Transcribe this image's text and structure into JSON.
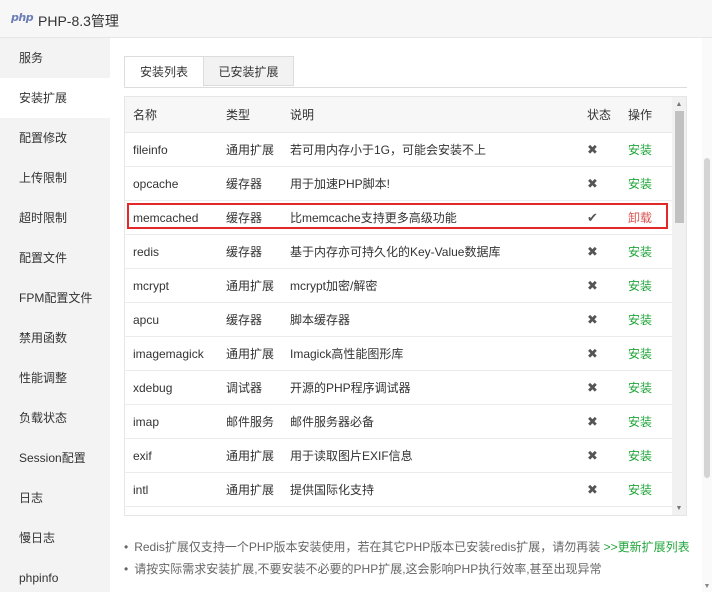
{
  "window": {
    "logo": "php",
    "title": "PHP-8.3管理"
  },
  "sidebar": {
    "items": [
      {
        "label": "服务",
        "active": false
      },
      {
        "label": "安装扩展",
        "active": true
      },
      {
        "label": "配置修改",
        "active": false
      },
      {
        "label": "上传限制",
        "active": false
      },
      {
        "label": "超时限制",
        "active": false
      },
      {
        "label": "配置文件",
        "active": false
      },
      {
        "label": "FPM配置文件",
        "active": false
      },
      {
        "label": "禁用函数",
        "active": false
      },
      {
        "label": "性能调整",
        "active": false
      },
      {
        "label": "负载状态",
        "active": false
      },
      {
        "label": "Session配置",
        "active": false
      },
      {
        "label": "日志",
        "active": false
      },
      {
        "label": "慢日志",
        "active": false
      },
      {
        "label": "phpinfo",
        "active": false
      }
    ]
  },
  "tabs": [
    {
      "label": "安装列表",
      "active": true
    },
    {
      "label": "已安装扩展",
      "active": false
    }
  ],
  "table": {
    "headers": {
      "name": "名称",
      "type": "类型",
      "desc": "说明",
      "status": "状态",
      "action": "操作"
    },
    "rows": [
      {
        "name": "fileinfo",
        "type": "通用扩展",
        "desc": "若可用内存小于1G，可能会安装不上",
        "installed": false,
        "action": "安装"
      },
      {
        "name": "opcache",
        "type": "缓存器",
        "desc": "用于加速PHP脚本!",
        "installed": false,
        "action": "安装"
      },
      {
        "name": "memcached",
        "type": "缓存器",
        "desc": "比memcache支持更多高级功能",
        "installed": true,
        "action": "卸载"
      },
      {
        "name": "redis",
        "type": "缓存器",
        "desc": "基于内存亦可持久化的Key-Value数据库",
        "installed": false,
        "action": "安装"
      },
      {
        "name": "mcrypt",
        "type": "通用扩展",
        "desc": "mcrypt加密/解密",
        "installed": false,
        "action": "安装"
      },
      {
        "name": "apcu",
        "type": "缓存器",
        "desc": "脚本缓存器",
        "installed": false,
        "action": "安装"
      },
      {
        "name": "imagemagick",
        "type": "通用扩展",
        "desc": "Imagick高性能图形库",
        "installed": false,
        "action": "安装"
      },
      {
        "name": "xdebug",
        "type": "调试器",
        "desc": "开源的PHP程序调试器",
        "installed": false,
        "action": "安装"
      },
      {
        "name": "imap",
        "type": "邮件服务",
        "desc": "邮件服务器必备",
        "installed": false,
        "action": "安装"
      },
      {
        "name": "exif",
        "type": "通用扩展",
        "desc": "用于读取图片EXIF信息",
        "installed": false,
        "action": "安装"
      },
      {
        "name": "intl",
        "type": "通用扩展",
        "desc": "提供国际化支持",
        "installed": false,
        "action": "安装"
      }
    ]
  },
  "notes": {
    "bullet": "•",
    "note1_text": "Redis扩展仅支持一个PHP版本安装使用，若在其它PHP版本已安装redis扩展，请勿再装",
    "note1_link": ">>更新扩展列表",
    "note2_text": "请按实际需求安装扩展,不要安装不必要的PHP扩展,这会影响PHP执行效率,甚至出现异常"
  },
  "icons": {
    "not_installed": "✖",
    "installed": "✔",
    "scroll_up": "▲",
    "scroll_down": "▼"
  },
  "colors": {
    "install": "#20a53a",
    "uninstall": "#d9534f",
    "highlight": "#e22828"
  }
}
